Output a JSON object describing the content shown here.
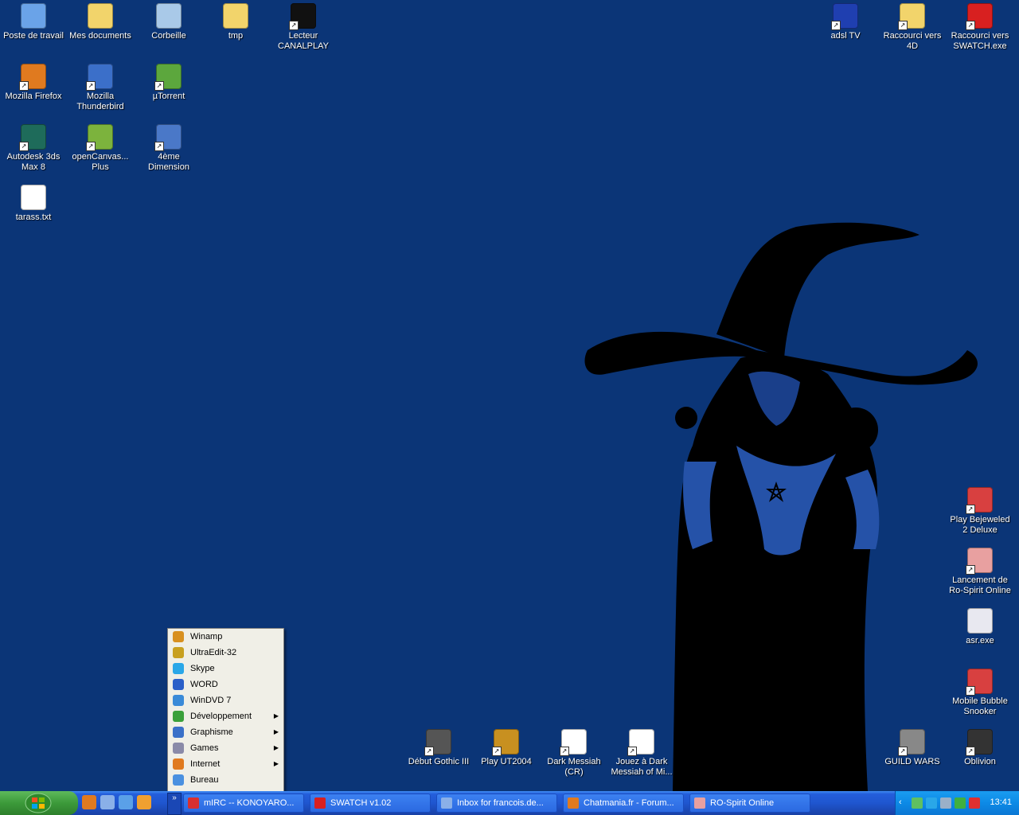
{
  "desktop_icons": [
    {
      "label": "Poste de travail",
      "icon": "computer-icon",
      "color": "#6aa3e8",
      "shortcut": false
    },
    {
      "label": "Mes documents",
      "icon": "folder-docs-icon",
      "color": "#f2d46b",
      "shortcut": false
    },
    {
      "label": "Corbeille",
      "icon": "recycle-bin-icon",
      "color": "#a9c9e8",
      "shortcut": false
    },
    {
      "label": "tmp",
      "icon": "folder-icon",
      "color": "#f2d46b",
      "shortcut": false
    },
    {
      "label": "Lecteur CANALPLAY",
      "icon": "play-icon",
      "color": "#111111",
      "shortcut": true
    },
    {
      "label": "Mozilla Firefox",
      "icon": "firefox-icon",
      "color": "#e07a1f",
      "shortcut": true
    },
    {
      "label": "Mozilla Thunderbird",
      "icon": "thunderbird-icon",
      "color": "#3b6fc9",
      "shortcut": true
    },
    {
      "label": "µTorrent",
      "icon": "utorrent-icon",
      "color": "#5ca73d",
      "shortcut": true
    },
    {
      "label": "Autodesk 3ds Max 8",
      "icon": "3dsmax-icon",
      "color": "#1e6b5a",
      "shortcut": true
    },
    {
      "label": "openCanvas... Plus",
      "icon": "opencanvas-icon",
      "color": "#7cb33d",
      "shortcut": true
    },
    {
      "label": "4ème Dimension",
      "icon": "4d-icon",
      "color": "#4a78c8",
      "shortcut": true
    },
    {
      "label": "tarass.txt",
      "icon": "text-file-icon",
      "color": "#ffffff",
      "shortcut": false
    },
    {
      "label": "adsl TV",
      "icon": "adsl-tv-icon",
      "color": "#1f3fb0",
      "shortcut": true
    },
    {
      "label": "Raccourci vers 4D",
      "icon": "folder-icon",
      "color": "#f2d46b",
      "shortcut": true
    },
    {
      "label": "Raccourci vers SWATCH.exe",
      "icon": "swatch-icon",
      "color": "#d82020",
      "shortcut": true
    },
    {
      "label": "Play Bejeweled 2 Deluxe",
      "icon": "bejeweled-icon",
      "color": "#d84040",
      "shortcut": true
    },
    {
      "label": "Lancement de Ro-Spirit Online",
      "icon": "ro-spirit-icon",
      "color": "#e8a0a0",
      "shortcut": true
    },
    {
      "label": "asr.exe",
      "icon": "window-app-icon",
      "color": "#e8e8f0",
      "shortcut": false
    },
    {
      "label": "Mobile Bubble Snooker",
      "icon": "snooker-icon",
      "color": "#d84040",
      "shortcut": true
    },
    {
      "label": "Début Gothic III",
      "icon": "gothic-icon",
      "color": "#555555",
      "shortcut": true
    },
    {
      "label": "Play UT2004",
      "icon": "ut2004-icon",
      "color": "#c89020",
      "shortcut": true
    },
    {
      "label": "Dark Messiah (CR)",
      "icon": "dark-messiah-icon",
      "color": "#ffffff",
      "shortcut": true
    },
    {
      "label": "Jouez à Dark Messiah of Mi...",
      "icon": "dark-messiah-icon",
      "color": "#ffffff",
      "shortcut": true
    },
    {
      "label": "GUILD WARS",
      "icon": "guild-wars-icon",
      "color": "#888888",
      "shortcut": true
    },
    {
      "label": "Oblivion",
      "icon": "oblivion-icon",
      "color": "#333333",
      "shortcut": true
    }
  ],
  "quick_menu": [
    {
      "label": "Winamp",
      "icon": "winamp-icon",
      "color": "#d89020",
      "submenu": false
    },
    {
      "label": "UltraEdit-32",
      "icon": "ultraedit-icon",
      "color": "#c8a020",
      "submenu": false
    },
    {
      "label": "Skype",
      "icon": "skype-icon",
      "color": "#2aa7e8",
      "submenu": false
    },
    {
      "label": "WORD",
      "icon": "word-icon",
      "color": "#2b5fc8",
      "submenu": false
    },
    {
      "label": "WinDVD 7",
      "icon": "windvd-icon",
      "color": "#3a8ad8",
      "submenu": false
    },
    {
      "label": "Développement",
      "icon": "dev-icon",
      "color": "#3aa03a",
      "submenu": true
    },
    {
      "label": "Graphisme",
      "icon": "graphics-icon",
      "color": "#3a70c8",
      "submenu": true
    },
    {
      "label": "Games",
      "icon": "games-icon",
      "color": "#8a8aa8",
      "submenu": true
    },
    {
      "label": "Internet",
      "icon": "firefox-icon",
      "color": "#e07a1f",
      "submenu": true
    },
    {
      "label": "Bureau",
      "icon": "desktop-icon",
      "color": "#4a90e0",
      "submenu": false
    }
  ],
  "taskbar": {
    "quicklaunch": [
      {
        "icon": "firefox-icon",
        "color": "#e07a1f"
      },
      {
        "icon": "thunderbird-icon",
        "color": "#8ab0e8"
      },
      {
        "icon": "network-icon",
        "color": "#5aa0e8"
      },
      {
        "icon": "messenger-icon",
        "color": "#f0a030"
      }
    ],
    "expand_label": "»",
    "tasks": [
      {
        "label": "mIRC -- KONOYARO...",
        "icon": "mirc-icon",
        "color": "#d83030"
      },
      {
        "label": "SWATCH v1.02",
        "icon": "swatch-icon",
        "color": "#d82020"
      },
      {
        "label": "Inbox for francois.de...",
        "icon": "thunderbird-icon",
        "color": "#8ab0e8"
      },
      {
        "label": "Chatmania.fr - Forum...",
        "icon": "firefox-icon",
        "color": "#e07a1f"
      },
      {
        "label": "RO-Spirit Online",
        "icon": "ro-spirit-icon",
        "color": "#e8a0a0"
      }
    ],
    "tray": {
      "arrow": "‹",
      "icons": [
        {
          "icon": "tray-shield-icon",
          "color": "#60c060"
        },
        {
          "icon": "tray-skype-icon",
          "color": "#2aa7e8"
        },
        {
          "icon": "tray-network-icon",
          "color": "#9ab0c8"
        },
        {
          "icon": "tray-monitor-icon",
          "color": "#40b040"
        },
        {
          "icon": "tray-antivirus-icon",
          "color": "#e03030"
        }
      ],
      "clock": "13:41"
    }
  }
}
